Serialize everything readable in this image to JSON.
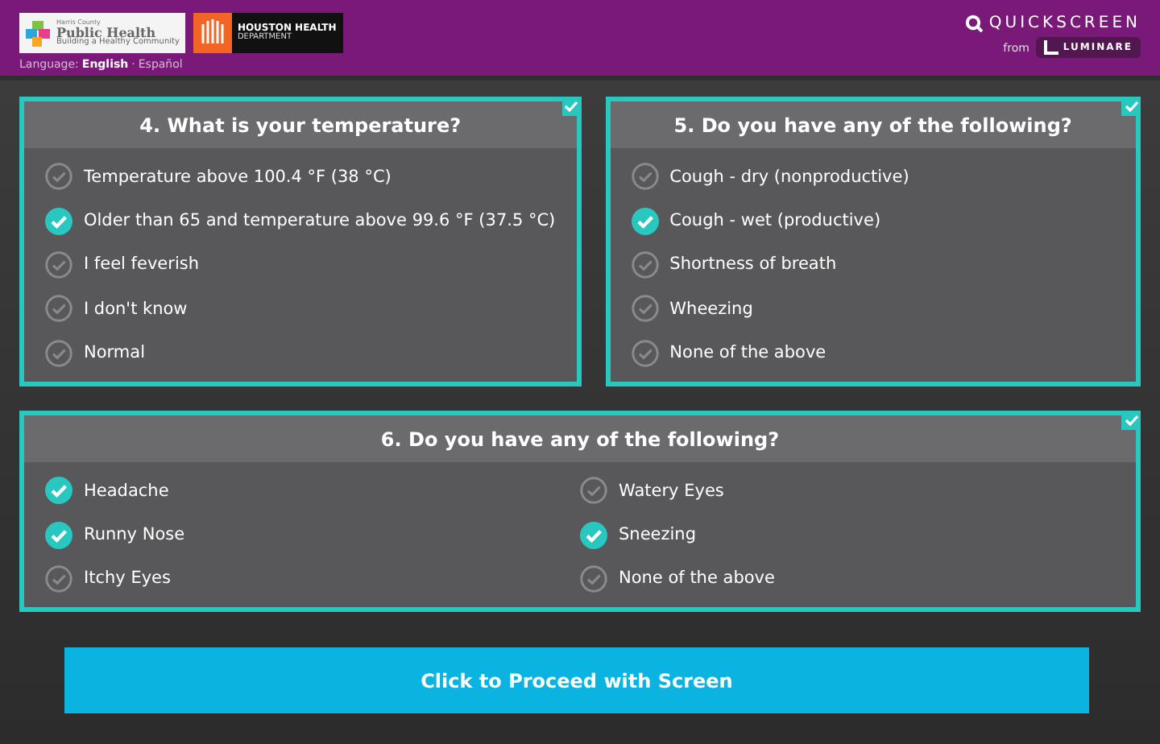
{
  "header": {
    "logos": [
      {
        "kind": "hcph",
        "line_1": "Harris County",
        "line_2": "Public Health",
        "line_3": "Building a Healthy Community"
      },
      {
        "kind": "hhd",
        "line_1": "HOUSTON HEALTH",
        "line_2": "DEPARTMENT"
      }
    ],
    "language": {
      "label": "Language:",
      "separator": "·",
      "options": [
        {
          "label": "English",
          "selected": true
        },
        {
          "label": "Español",
          "selected": false
        }
      ]
    },
    "brand": {
      "name": "QUICKSCREEN",
      "from": "from",
      "partner": "LUMINARE"
    }
  },
  "questions": [
    {
      "title": "4. What is your temperature?",
      "answered": true,
      "kind": "list",
      "options": [
        {
          "label": "Temperature above 100.4 °F (38 °C)",
          "checked": false
        },
        {
          "label": "Older than 65 and temperature above 99.6 °F (37.5 °C)",
          "checked": true
        },
        {
          "label": "I feel feverish",
          "checked": false
        },
        {
          "label": "I don't know",
          "checked": false
        },
        {
          "label": "Normal",
          "checked": false
        }
      ]
    },
    {
      "title": "5. Do you have any of the following?",
      "answered": true,
      "kind": "list",
      "options": [
        {
          "label": "Cough - dry (nonproductive)",
          "checked": false
        },
        {
          "label": "Cough - wet (productive)",
          "checked": true
        },
        {
          "label": "Shortness of breath",
          "checked": false
        },
        {
          "label": "Wheezing",
          "checked": false
        },
        {
          "label": "None of the above",
          "checked": false
        }
      ]
    },
    {
      "title": "6. Do you have any of the following?",
      "answered": true,
      "kind": "grid",
      "options": [
        {
          "label": "Headache",
          "checked": true
        },
        {
          "label": "Runny Nose",
          "checked": true
        },
        {
          "label": "Itchy Eyes",
          "checked": false
        },
        {
          "label": "Watery Eyes",
          "checked": false
        },
        {
          "label": "Sneezing",
          "checked": true
        },
        {
          "label": "None of the above",
          "checked": false
        }
      ]
    }
  ],
  "proceed_button": {
    "label": "Click to Proceed with Screen"
  }
}
